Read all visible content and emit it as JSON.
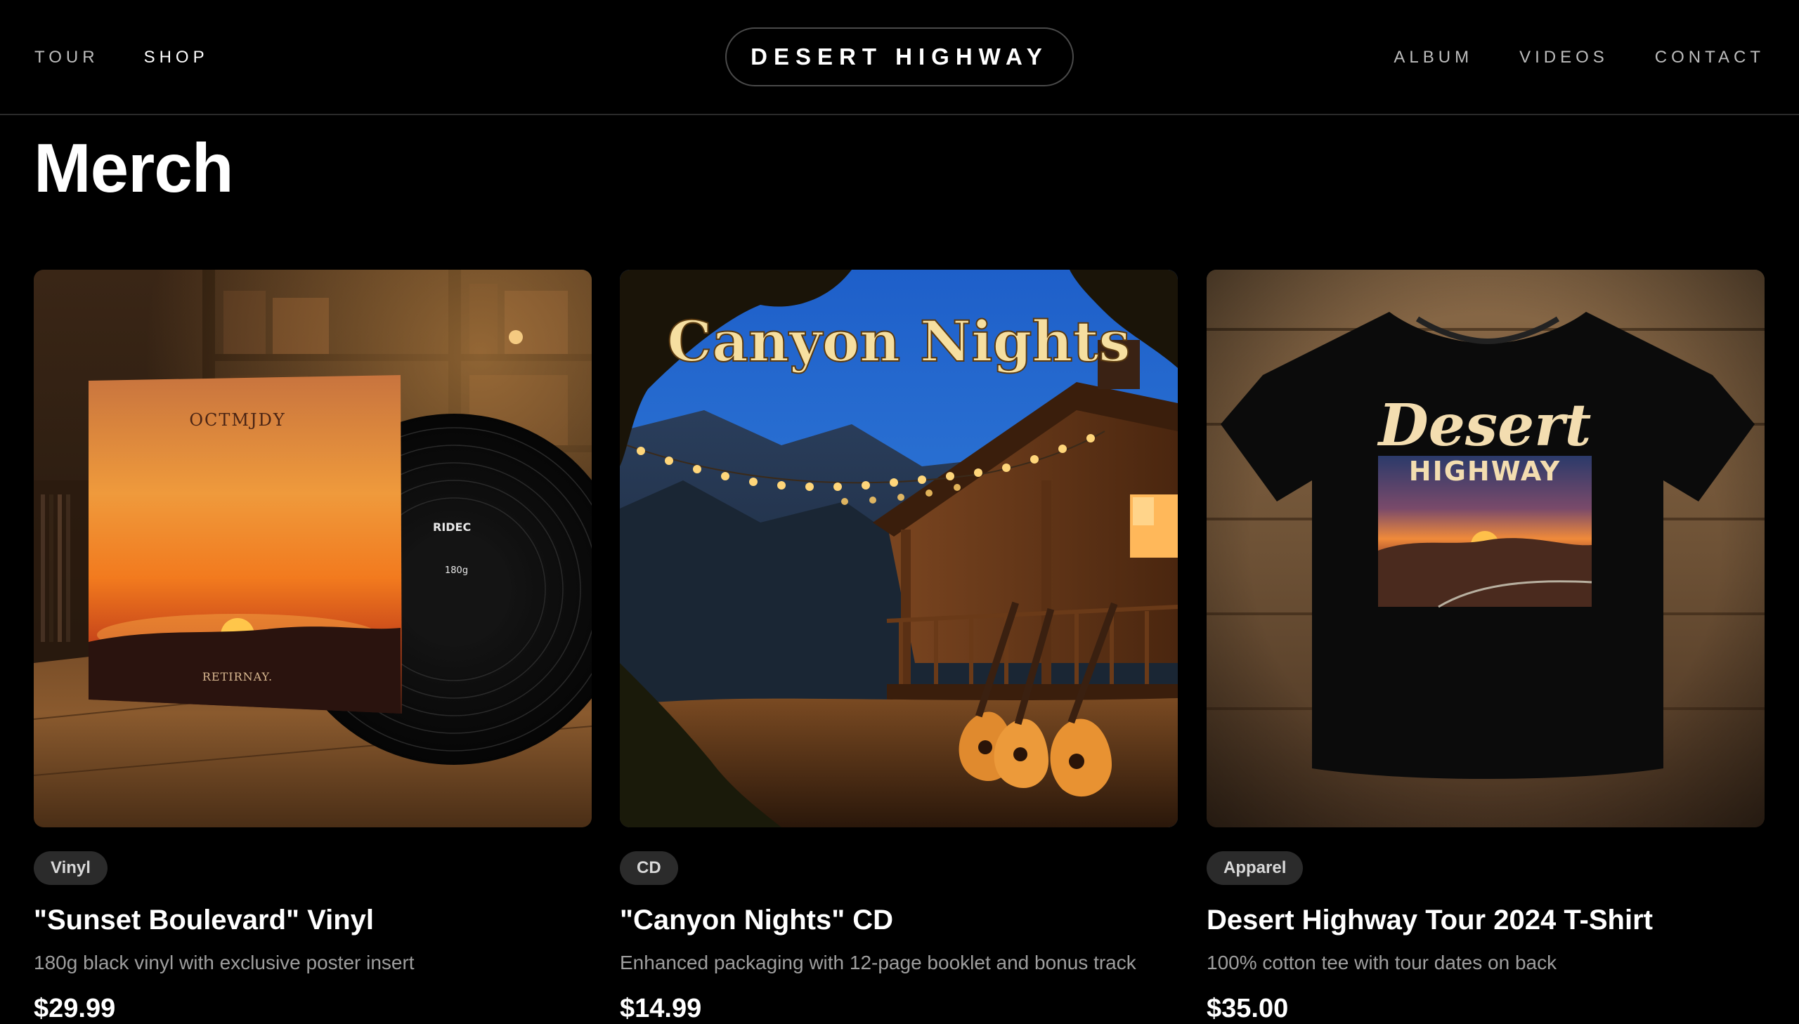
{
  "nav": {
    "left": [
      {
        "label": "TOUR",
        "active": false
      },
      {
        "label": "SHOP",
        "active": true
      }
    ],
    "brand": "DESERT HIGHWAY",
    "right": [
      {
        "label": "ALBUM"
      },
      {
        "label": "VIDEOS"
      },
      {
        "label": "CONTACT"
      }
    ]
  },
  "page": {
    "title": "Merch"
  },
  "products": [
    {
      "category": "Vinyl",
      "title": "\"Sunset Boulevard\" Vinyl",
      "description": "180g black vinyl with exclusive poster insert",
      "price": "$29.99",
      "image": {
        "sleeve_top_text": "OCTMJDY",
        "sleeve_bottom_text": "RETIRNAY.",
        "label_text": "RIDEC",
        "label_weight": "180g"
      }
    },
    {
      "category": "CD",
      "title": "\"Canyon Nights\" CD",
      "description": "Enhanced packaging with 12-page booklet and bonus track",
      "price": "$14.99",
      "image": {
        "headline": "Canyon Nights"
      }
    },
    {
      "category": "Apparel",
      "title": "Desert Highway Tour 2024 T-Shirt",
      "description": "100% cotton tee with tour dates on back",
      "price": "$35.00",
      "image": {
        "print_script": "Desert",
        "print_caps": "HIGHWAY"
      }
    }
  ],
  "colors": {
    "background": "#000000",
    "badge_bg": "#2b2b2b",
    "muted_text": "#9e9e9e",
    "sunset_orange": "#f08a24",
    "cd_title_gold": "#f6dfa0"
  }
}
